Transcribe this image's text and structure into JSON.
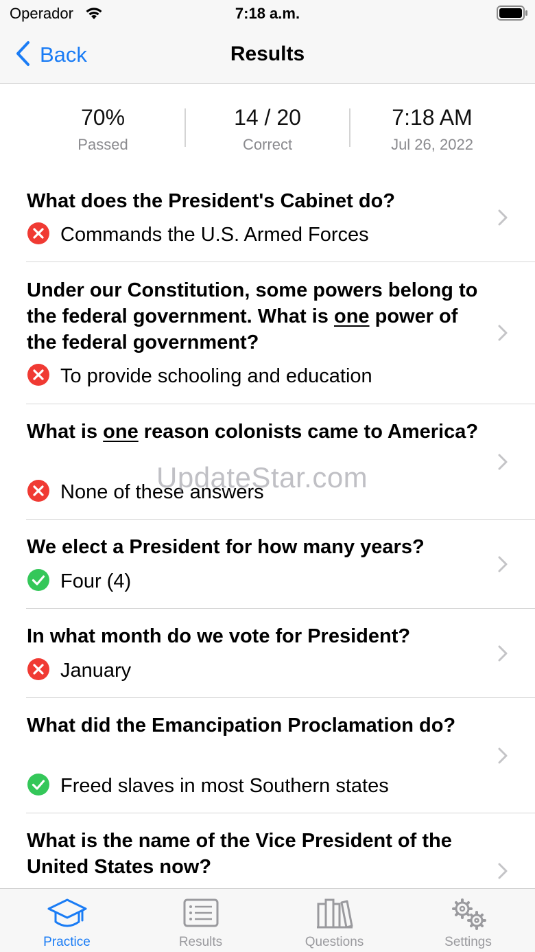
{
  "status_bar": {
    "carrier": "Operador",
    "time": "7:18 a.m."
  },
  "nav": {
    "back_label": "Back",
    "title": "Results"
  },
  "summary": {
    "score": {
      "value": "70%",
      "label": "Passed"
    },
    "correct": {
      "value": "14 / 20",
      "label": "Correct"
    },
    "when": {
      "value": "7:18 AM",
      "label": "Jul 26, 2022"
    }
  },
  "results": [
    {
      "q": "What does the President's Cabinet do?",
      "a": "Commands the U.S. Armed Forces",
      "correct": false
    },
    {
      "q1": "Under our Constitution, some powers belong to the federal government. What is ",
      "u": "one",
      "q2": " power of the federal government?",
      "a": "To provide schooling and education",
      "correct": false
    },
    {
      "q1": "What is ",
      "u": "one",
      "q2": " reason colonists came to America?",
      "a": "None of these answers",
      "correct": false
    },
    {
      "q": "We elect a President for how many years?",
      "a": "Four (4)",
      "correct": true
    },
    {
      "q": "In what month do we vote for President?",
      "a": "January",
      "correct": false
    },
    {
      "q": "What did the Emancipation Proclamation do?",
      "a": "Freed slaves in most Southern states",
      "correct": true
    },
    {
      "q": "What is the name of the Vice President of the United States now?"
    }
  ],
  "watermark": "UpdateStar.com",
  "tabs": [
    {
      "label": "Practice",
      "icon": "graduation-cap-icon",
      "active": true
    },
    {
      "label": "Results",
      "icon": "list-icon",
      "active": false
    },
    {
      "label": "Questions",
      "icon": "books-icon",
      "active": false
    },
    {
      "label": "Settings",
      "icon": "gears-icon",
      "active": false
    }
  ],
  "colors": {
    "accent": "#1a7cf5",
    "wrong": "#f03a33",
    "right": "#34c759",
    "inactive": "#9a9a9e"
  }
}
